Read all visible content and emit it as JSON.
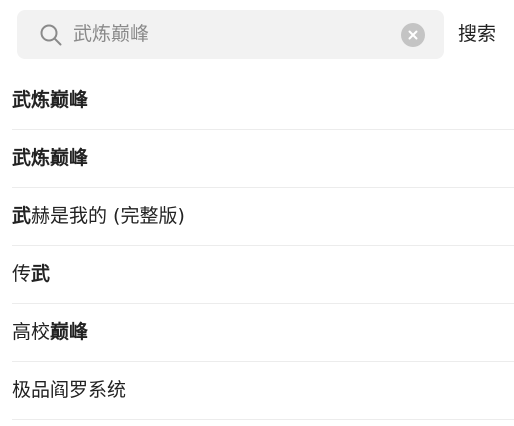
{
  "search": {
    "value": "武炼巅峰",
    "action_label": "搜索",
    "icons": {
      "search": "search-icon",
      "clear": "clear-icon"
    }
  },
  "suggestions": [
    {
      "segments": [
        {
          "text": "武炼巅峰",
          "bold": true
        }
      ]
    },
    {
      "segments": [
        {
          "text": "武炼巅峰",
          "bold": true
        }
      ]
    },
    {
      "segments": [
        {
          "text": "武",
          "bold": true
        },
        {
          "text": "赫是我的 (完整版)",
          "bold": false
        }
      ]
    },
    {
      "segments": [
        {
          "text": "传",
          "bold": false
        },
        {
          "text": "武",
          "bold": true
        }
      ]
    },
    {
      "segments": [
        {
          "text": "高校",
          "bold": false
        },
        {
          "text": "巅峰",
          "bold": true
        }
      ]
    },
    {
      "segments": [
        {
          "text": "极品阎罗系统",
          "bold": false
        }
      ]
    }
  ],
  "colors": {
    "search_box_bg": "#f2f2f2",
    "placeholder_text": "#8a8a8a",
    "clear_button_bg": "#c4c4c4",
    "divider": "#ececec",
    "text": "#222222"
  }
}
